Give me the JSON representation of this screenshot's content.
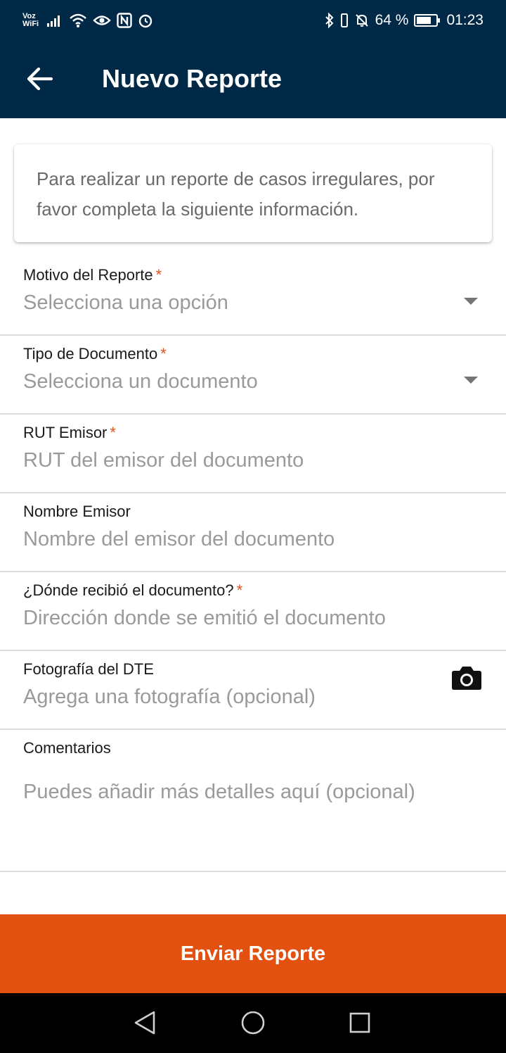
{
  "status_bar": {
    "voz_top": "Voz",
    "voz_bottom": "WiFi",
    "battery_percent": "64 %",
    "time": "01:23",
    "left_icons": [
      "signal-icon",
      "wifi-icon",
      "eye-icon",
      "nfc-icon",
      "alarm-icon"
    ],
    "right_icons": [
      "bluetooth-icon",
      "vibrate-icon",
      "mute-icon",
      "battery-icon"
    ]
  },
  "app_bar": {
    "title": "Nuevo Reporte",
    "background": "#002847"
  },
  "intro_card": {
    "text": "Para realizar un reporte de casos irregulares, por favor completa la siguiente información."
  },
  "form": {
    "fields": [
      {
        "label": "Motivo del Reporte",
        "required_mark": "*",
        "placeholder": "Selecciona una opción"
      },
      {
        "label": "Tipo de Documento",
        "required_mark": "*",
        "placeholder": "Selecciona un documento"
      },
      {
        "label": "RUT Emisor",
        "required_mark": "*",
        "placeholder": "RUT del emisor del documento"
      },
      {
        "label": "Nombre Emisor",
        "required_mark": "",
        "placeholder": "Nombre del emisor del documento"
      },
      {
        "label": "¿Dónde recibió el documento?",
        "required_mark": "*",
        "placeholder": "Dirección donde se emitió el documento"
      },
      {
        "label": "Fotografía del DTE",
        "required_mark": "",
        "placeholder": "Agrega una fotografía (opcional)"
      },
      {
        "label": "Comentarios",
        "required_mark": "",
        "placeholder": "Puedes añadir más detalles aquí (opcional)"
      }
    ]
  },
  "submit": {
    "label": "Enviar Reporte",
    "background": "#e2510f"
  },
  "nav_bar": {
    "icons": [
      "back-triangle-icon",
      "home-circle-icon",
      "recents-square-icon"
    ]
  }
}
